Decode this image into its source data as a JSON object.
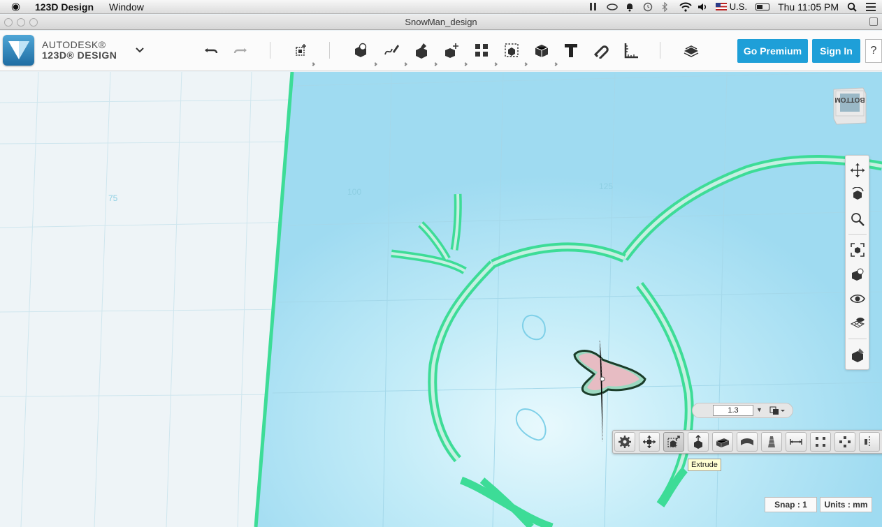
{
  "menubar": {
    "app_name": "123D Design",
    "menus": [
      "Window"
    ],
    "input_source": "U.S.",
    "clock": "Thu 11:05 PM"
  },
  "window": {
    "title": "SnowMan_design"
  },
  "brand": {
    "line1": "AUTODESK®",
    "line2": "123D® DESIGN"
  },
  "toolbar": {
    "premium_label": "Go Premium",
    "signin_label": "Sign In",
    "help_label": "?"
  },
  "viewport": {
    "grid_labels": [
      "75",
      "100",
      "125"
    ],
    "viewcube_label": "BOTTOM"
  },
  "extrude": {
    "value": "1.3",
    "tooltip": "Extrude"
  },
  "status": {
    "snap": "Snap : 1",
    "units": "Units : mm"
  },
  "colors": {
    "accent": "#1e9fd8",
    "sketch_green": "#3ddc97",
    "plane_blue": "#b4e3f4"
  }
}
